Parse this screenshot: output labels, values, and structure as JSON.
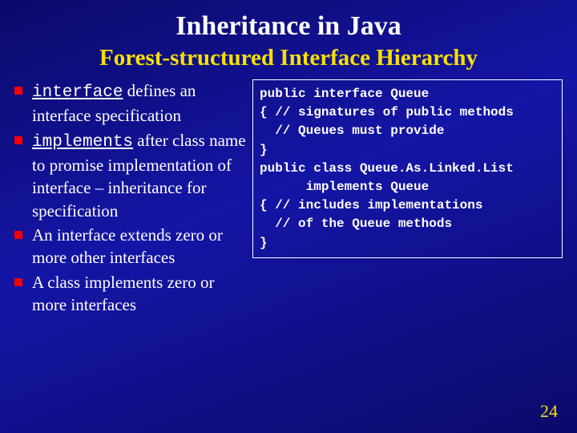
{
  "title": "Inheritance in Java",
  "subtitle": "Forest-structured Interface Hierarchy",
  "bullets": {
    "b1_kw": "interface",
    "b1_rest": " defines an interface specification",
    "b2_kw": "implements",
    "b2_rest": " after class name to promise implementation of interface – inheritance for specification",
    "b3": "An interface extends zero or more other interfaces",
    "b4": "A class implements zero or more interfaces"
  },
  "code": "public interface Queue\n{ // signatures of public methods\n  // Queues must provide\n}\npublic class Queue.As.Linked.List\n      implements Queue\n{ // includes implementations\n  // of the Queue methods\n}",
  "page_number": "24"
}
